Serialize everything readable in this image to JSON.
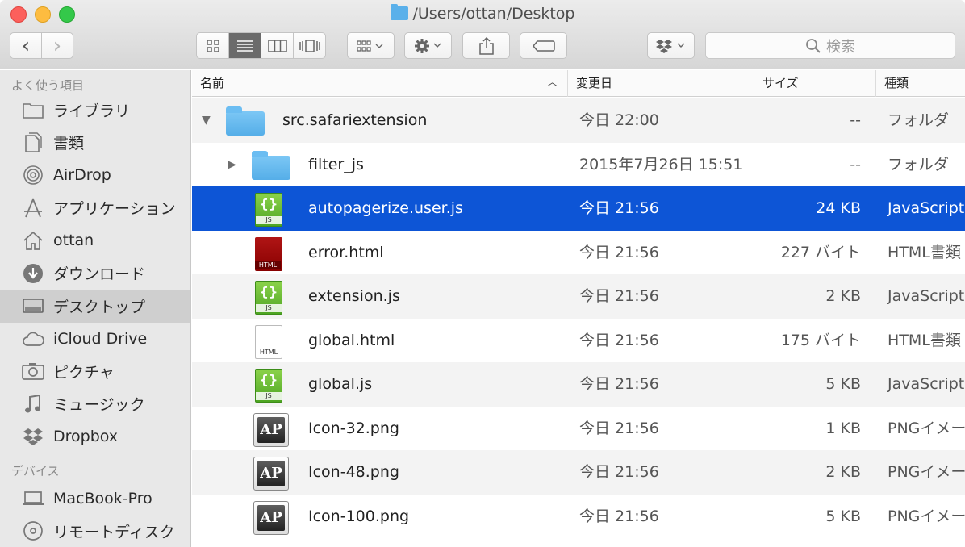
{
  "window": {
    "title": "/Users/ottan/Desktop"
  },
  "toolbar": {
    "back_label": "‹",
    "forward_label": "›",
    "search_placeholder": "検索"
  },
  "sidebar": {
    "favorites_heading": "よく使う項目",
    "favorites": [
      {
        "label": "ライブラリ",
        "icon": "folder-icon"
      },
      {
        "label": "書類",
        "icon": "documents-icon"
      },
      {
        "label": "AirDrop",
        "icon": "airdrop-icon"
      },
      {
        "label": "アプリケーション",
        "icon": "applications-icon"
      },
      {
        "label": "ottan",
        "icon": "home-icon"
      },
      {
        "label": "ダウンロード",
        "icon": "download-icon"
      },
      {
        "label": "デスクトップ",
        "icon": "desktop-icon",
        "selected": true
      },
      {
        "label": "iCloud Drive",
        "icon": "cloud-icon"
      },
      {
        "label": "ピクチャ",
        "icon": "camera-icon"
      },
      {
        "label": "ミュージック",
        "icon": "music-icon"
      },
      {
        "label": "Dropbox",
        "icon": "dropbox-icon"
      }
    ],
    "devices_heading": "デバイス",
    "devices": [
      {
        "label": "MacBook-Pro",
        "icon": "laptop-icon"
      },
      {
        "label": "リモートディスク",
        "icon": "disc-icon"
      }
    ]
  },
  "columns": {
    "name": "名前",
    "modified": "変更日",
    "size": "サイズ",
    "kind": "種類"
  },
  "files": [
    {
      "name": "src.safariextension",
      "date": "今日 22:00",
      "size": "--",
      "kind": "フォルダ",
      "icon": "folder-icon",
      "disclosure": "▼",
      "indent": 0
    },
    {
      "name": "filter_js",
      "date": "2015年7月26日 15:51",
      "size": "--",
      "kind": "フォルダ",
      "icon": "folder-icon",
      "disclosure": "▶",
      "indent": 1
    },
    {
      "name": "autopagerize.user.js",
      "date": "今日 21:56",
      "size": "24 KB",
      "kind": "JavaScript",
      "icon": "js-file-icon",
      "indent": 1,
      "selected": true
    },
    {
      "name": "error.html",
      "date": "今日 21:56",
      "size": "227 バイト",
      "kind": "HTML書類",
      "icon": "html-file-icon",
      "indent": 1
    },
    {
      "name": "extension.js",
      "date": "今日 21:56",
      "size": "2 KB",
      "kind": "JavaScript",
      "icon": "js-file-icon",
      "indent": 1
    },
    {
      "name": "global.html",
      "date": "今日 21:56",
      "size": "175 バイト",
      "kind": "HTML書類",
      "icon": "html-file-icon",
      "indent": 1
    },
    {
      "name": "global.js",
      "date": "今日 21:56",
      "size": "5 KB",
      "kind": "JavaScript",
      "icon": "js-file-icon",
      "indent": 1
    },
    {
      "name": "Icon-32.png",
      "date": "今日 21:56",
      "size": "1 KB",
      "kind": "PNGイメージ",
      "icon": "png-file-icon",
      "indent": 1
    },
    {
      "name": "Icon-48.png",
      "date": "今日 21:56",
      "size": "2 KB",
      "kind": "PNGイメージ",
      "icon": "png-file-icon",
      "indent": 1
    },
    {
      "name": "Icon-100.png",
      "date": "今日 21:56",
      "size": "5 KB",
      "kind": "PNGイメージ",
      "icon": "png-file-icon",
      "indent": 1
    }
  ],
  "icon_labels": {
    "js": "JS",
    "html": "HTML",
    "ap": "AP",
    "braces": "{}"
  },
  "colors": {
    "selection": "#0d55d6",
    "folder": "#5ab0ea"
  }
}
